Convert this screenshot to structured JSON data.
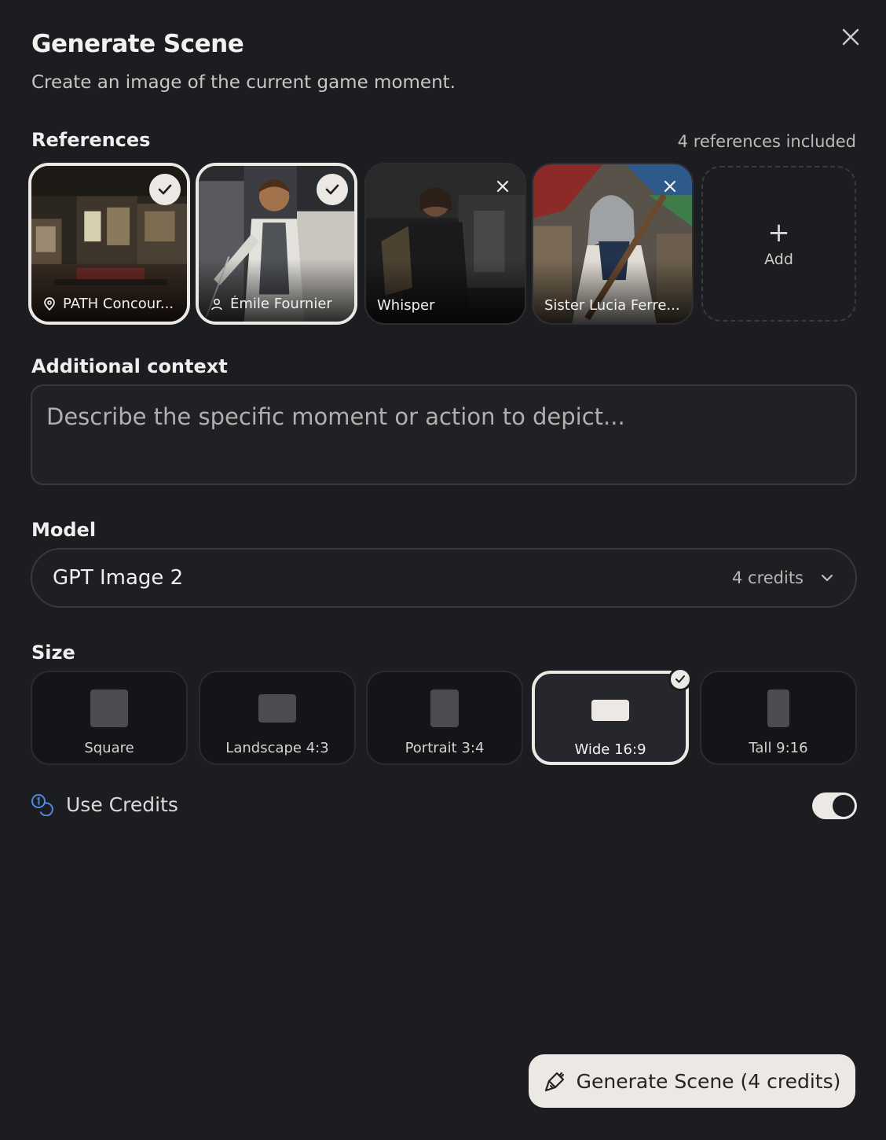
{
  "dialog": {
    "title": "Generate Scene",
    "subtitle": "Create an image of the current game moment."
  },
  "references": {
    "label": "References",
    "count_text": "4 references included",
    "items": [
      {
        "label": "PATH Concour...",
        "icon": "location-pin-icon",
        "selected": true
      },
      {
        "label": "Émile Fournier",
        "icon": "person-icon",
        "selected": true
      },
      {
        "label": "Whisper",
        "selected": false
      },
      {
        "label": "Sister Lucia Ferre...",
        "selected": false
      }
    ],
    "add_label": "Add"
  },
  "context": {
    "label": "Additional context",
    "placeholder": "Describe the specific moment or action to depict..."
  },
  "model": {
    "label": "Model",
    "selected": "GPT Image 2",
    "credits": "4 credits"
  },
  "size": {
    "label": "Size",
    "options": [
      {
        "label": "Square"
      },
      {
        "label": "Landscape 4:3"
      },
      {
        "label": "Portrait 3:4"
      },
      {
        "label": "Wide 16:9",
        "selected": true
      },
      {
        "label": "Tall 9:16"
      }
    ]
  },
  "use_credits": {
    "label": "Use Credits",
    "enabled": true
  },
  "generate_button": {
    "label": "Generate Scene (4 credits)"
  },
  "colors": {
    "background": "#1c1d21",
    "accent": "#ece8e3",
    "credits_icon": "#4d8be8"
  }
}
